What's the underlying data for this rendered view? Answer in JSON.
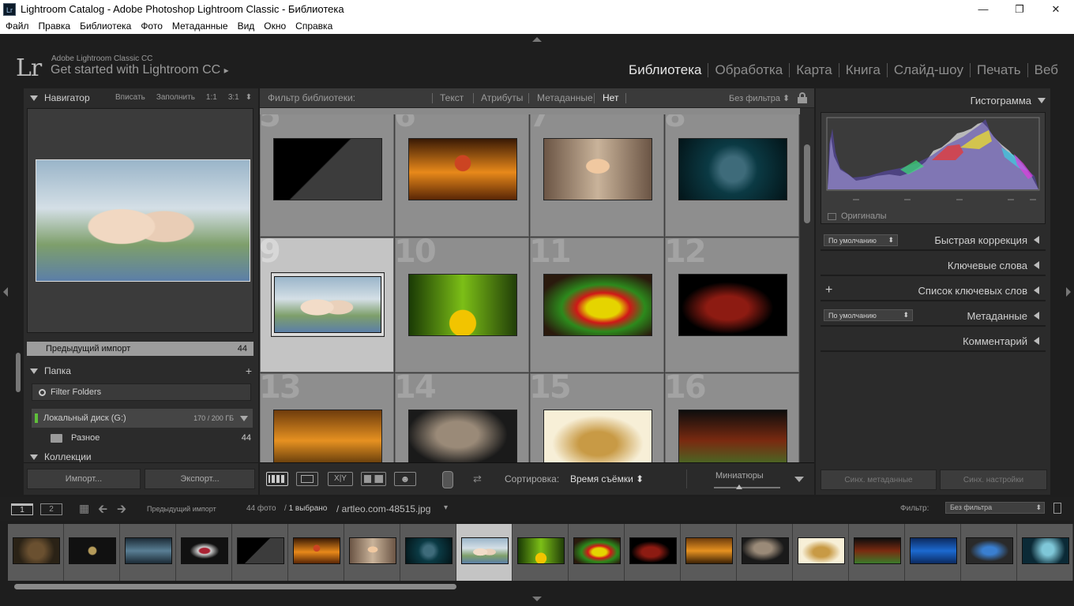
{
  "window": {
    "title": "Lightroom Catalog - Adobe Photoshop Lightroom Classic - Библиотека",
    "app_icon": "Lr"
  },
  "menu": [
    "Файл",
    "Правка",
    "Библиотека",
    "Фото",
    "Метаданные",
    "Вид",
    "Окно",
    "Справка"
  ],
  "identity": {
    "logo": "Lr",
    "product": "Adobe Lightroom Classic CC",
    "tagline": "Get started with Lightroom CC",
    "play": "▸"
  },
  "modules": [
    {
      "label": "Библиотека",
      "active": true
    },
    {
      "label": "Обработка",
      "active": false
    },
    {
      "label": "Карта",
      "active": false
    },
    {
      "label": "Книга",
      "active": false
    },
    {
      "label": "Слайд-шоу",
      "active": false
    },
    {
      "label": "Печать",
      "active": false
    },
    {
      "label": "Веб",
      "active": false
    }
  ],
  "navigator": {
    "title": "Навигатор",
    "options": [
      "Вписать",
      "Заполнить",
      "1:1",
      "3:1"
    ]
  },
  "catalog": {
    "previous_import_label": "Предыдущий импорт",
    "previous_import_count": "44"
  },
  "folders": {
    "title": "Папка",
    "filter_placeholder": "Filter Folders",
    "disk": {
      "name": "Локальный диск (G:)",
      "size": "170 / 200 ГБ"
    },
    "items": [
      {
        "name": "Разное",
        "count": "44"
      }
    ]
  },
  "collections": {
    "title": "Коллекции"
  },
  "left_footer": {
    "import": "Импорт...",
    "export": "Экспорт..."
  },
  "filter_bar": {
    "title": "Фильтр библиотеки:",
    "tabs": [
      "Текст",
      "Атрибуты",
      "Метаданные",
      "Нет"
    ],
    "active_tab": "Нет",
    "preset": "Без фильтра ⬍"
  },
  "grid": {
    "cells": [
      {
        "num": "5",
        "thumb": "g1"
      },
      {
        "num": "6",
        "thumb": "g2"
      },
      {
        "num": "7",
        "thumb": "g3"
      },
      {
        "num": "8",
        "thumb": "g4"
      },
      {
        "num": "9",
        "thumb": "g5",
        "selected": true
      },
      {
        "num": "10",
        "thumb": "g6"
      },
      {
        "num": "11",
        "thumb": "g7"
      },
      {
        "num": "12",
        "thumb": "g8"
      },
      {
        "num": "13",
        "thumb": "g9"
      },
      {
        "num": "14",
        "thumb": "g10"
      },
      {
        "num": "15",
        "thumb": "g11"
      },
      {
        "num": "16",
        "thumb": "g12"
      }
    ]
  },
  "toolbar": {
    "sort_label": "Сортировка:",
    "sort_value": "Время съёмки ⬍",
    "thumbs_label": "Миниатюры",
    "thumb_slider": 0.5
  },
  "right_panel": {
    "histogram_title": "Гистограмма",
    "originals_label": "Оригиналы",
    "quick_develop": {
      "title": "Быстрая коррекция",
      "preset": "По умолчанию"
    },
    "keywording": {
      "title": "Ключевые слова"
    },
    "keyword_list": {
      "title": "Список ключевых слов"
    },
    "metadata": {
      "title": "Метаданные",
      "preset": "По умолчанию"
    },
    "comments": {
      "title": "Комментарий"
    },
    "sync_metadata": "Синх. метаданные",
    "sync_settings": "Синх. настройки"
  },
  "filmbar": {
    "screen1": "1",
    "screen2": "2",
    "source": "Предыдущий импорт",
    "count": "44 фото",
    "selected": "1 выбрано",
    "filename": "/ artleo.com-48515.jpg",
    "filter_label": "Фильтр:",
    "filter_value": "Без фильтра"
  },
  "filmstrip": [
    "g13",
    "g14",
    "g15",
    "g16",
    "g1",
    "g2",
    "g3",
    "g4",
    "g5",
    "g6",
    "g7",
    "g8",
    "g9",
    "g10",
    "g11",
    "g12",
    "g17",
    "g18",
    "g19"
  ],
  "filmstrip_selected_index": 8,
  "colors": {
    "accent_active": "#e6e6e6",
    "panel": "#2b2b2b",
    "grid_cell": "#8e8e8e",
    "selected_cell": "#c4c4c4"
  }
}
